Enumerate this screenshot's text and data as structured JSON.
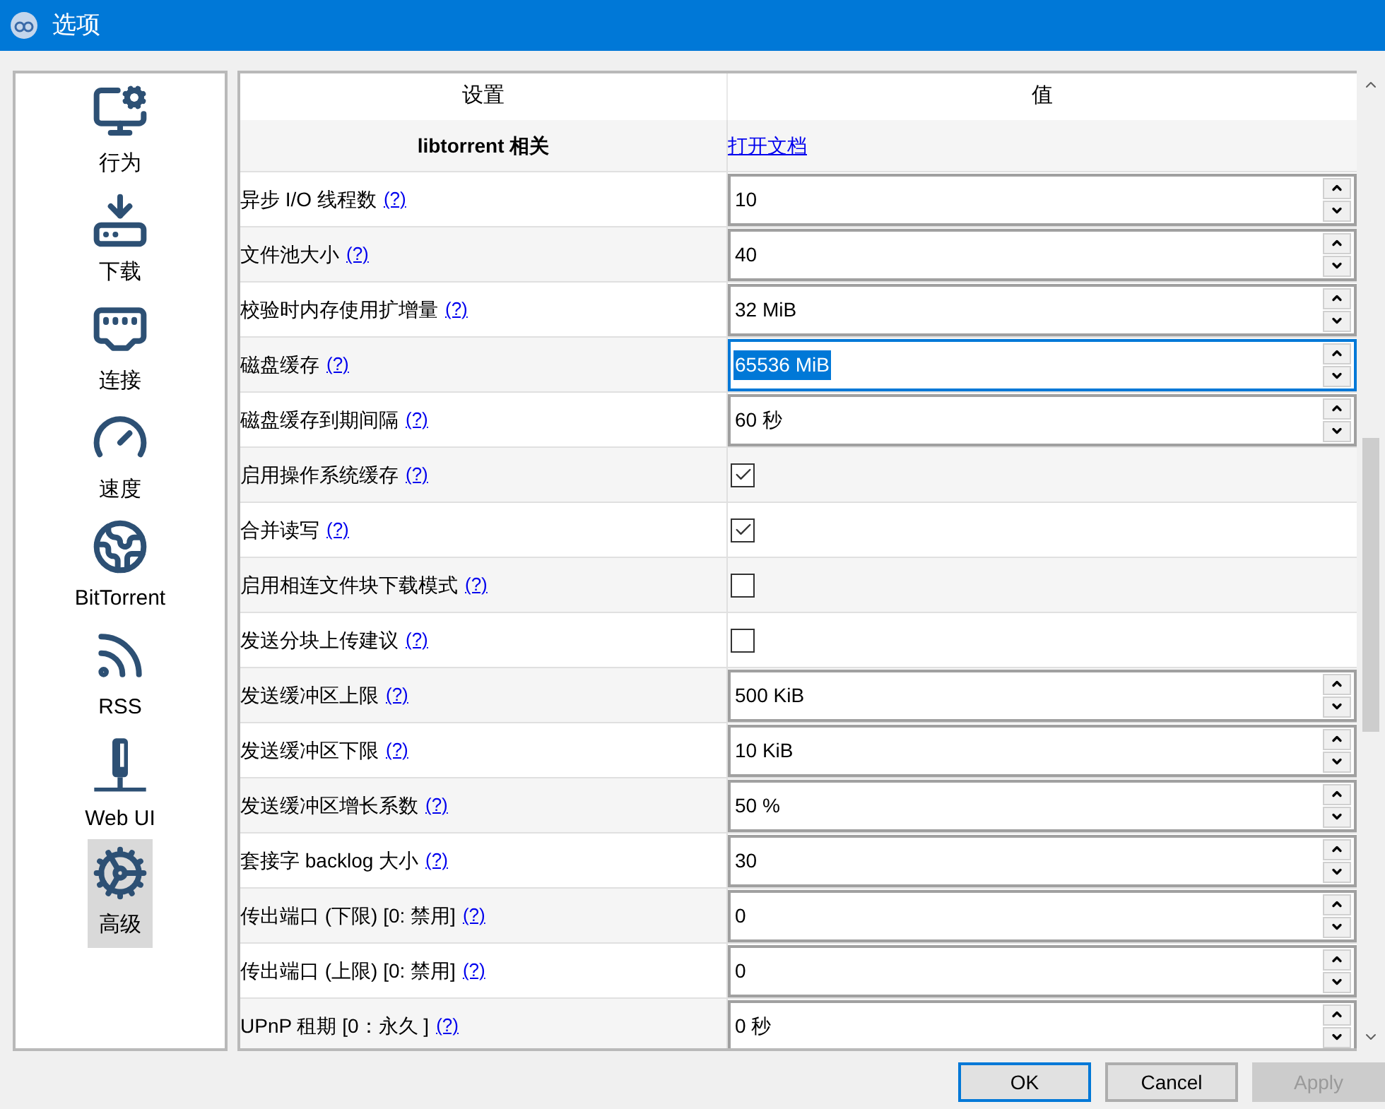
{
  "window": {
    "title": "选项"
  },
  "sidebar": {
    "items": [
      {
        "label": "行为",
        "selected": false
      },
      {
        "label": "下载",
        "selected": false
      },
      {
        "label": "连接",
        "selected": false
      },
      {
        "label": "速度",
        "selected": false
      },
      {
        "label": "BitTorrent",
        "selected": false
      },
      {
        "label": "RSS",
        "selected": false
      },
      {
        "label": "Web UI",
        "selected": false
      },
      {
        "label": "高级",
        "selected": true
      }
    ]
  },
  "table": {
    "columns": [
      "设置",
      "值"
    ],
    "section": {
      "label": "libtorrent 相关",
      "link": "打开文档"
    },
    "rows": [
      {
        "label": "异步 I/O 线程数",
        "help": "(?)",
        "kind": "spin",
        "value": "10",
        "focused": false
      },
      {
        "label": "文件池大小",
        "help": "(?)",
        "kind": "spin",
        "value": "40",
        "focused": false
      },
      {
        "label": "校验时内存使用扩增量",
        "help": "(?)",
        "kind": "spin",
        "value": "32 MiB",
        "focused": false
      },
      {
        "label": "磁盘缓存",
        "help": "(?)",
        "kind": "spin",
        "value": "65536 MiB",
        "focused": true
      },
      {
        "label": "磁盘缓存到期间隔",
        "help": "(?)",
        "kind": "spin",
        "value": "60 秒",
        "focused": false
      },
      {
        "label": "启用操作系统缓存",
        "help": "(?)",
        "kind": "check",
        "checked": true
      },
      {
        "label": "合并读写",
        "help": "(?)",
        "kind": "check",
        "checked": true
      },
      {
        "label": "启用相连文件块下载模式",
        "help": "(?)",
        "kind": "check",
        "checked": false
      },
      {
        "label": "发送分块上传建议",
        "help": "(?)",
        "kind": "check",
        "checked": false
      },
      {
        "label": "发送缓冲区上限",
        "help": "(?)",
        "kind": "spin",
        "value": "500 KiB",
        "focused": false
      },
      {
        "label": "发送缓冲区下限",
        "help": "(?)",
        "kind": "spin",
        "value": "10 KiB",
        "focused": false
      },
      {
        "label": "发送缓冲区增长系数",
        "help": "(?)",
        "kind": "spin",
        "value": "50 %",
        "focused": false
      },
      {
        "label": "套接字 backlog 大小",
        "help": "(?)",
        "kind": "spin",
        "value": "30",
        "focused": false
      },
      {
        "label": "传出端口 (下限) [0: 禁用]",
        "help": "(?)",
        "kind": "spin",
        "value": "0",
        "focused": false
      },
      {
        "label": "传出端口 (上限) [0: 禁用]",
        "help": "(?)",
        "kind": "spin",
        "value": "0",
        "focused": false
      },
      {
        "label": "UPnP 租期 [0：永久 ]",
        "help": "(?)",
        "kind": "spin",
        "value": "0 秒",
        "focused": false
      }
    ]
  },
  "buttons": [
    {
      "label": "OK",
      "default": true,
      "disabled": false
    },
    {
      "label": "Cancel",
      "default": false,
      "disabled": false
    },
    {
      "label": "Apply",
      "default": false,
      "disabled": true
    }
  ]
}
